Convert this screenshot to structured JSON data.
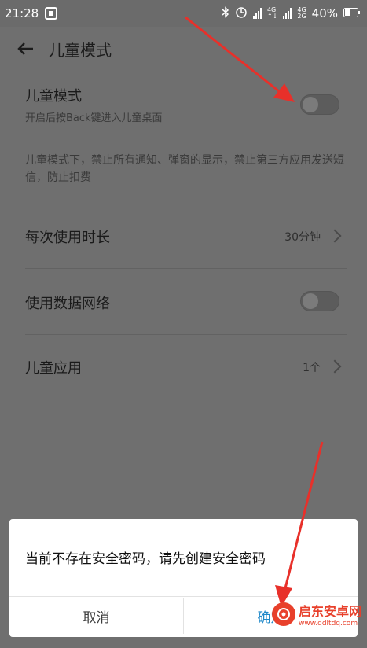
{
  "status_bar": {
    "time": "21:28",
    "network_a": "4G",
    "network_b": "4G",
    "network_b2": "2G",
    "battery": "40%"
  },
  "header": {
    "title": "儿童模式"
  },
  "rows": {
    "kid_mode": {
      "label": "儿童模式",
      "sub": "开启后按Back键进入儿童桌面",
      "enabled": false
    },
    "description": "儿童模式下，禁止所有通知、弹窗的显示，禁止第三方应用发送短信，防止扣费",
    "duration": {
      "label": "每次使用时长",
      "value": "30分钟"
    },
    "mobile_data": {
      "label": "使用数据网络",
      "enabled": false
    },
    "kid_apps": {
      "label": "儿童应用",
      "value": "1个"
    }
  },
  "dialog": {
    "message": "当前不存在安全密码，请先创建安全密码",
    "cancel_label": "取消",
    "confirm_label": "确定"
  },
  "watermark": {
    "name": "启东安卓网",
    "url": "www.qdltdq.com"
  },
  "colors": {
    "overlay": "#6f6f6f",
    "accent": "#1e88c9",
    "annotation_arrow": "#e8302a"
  }
}
